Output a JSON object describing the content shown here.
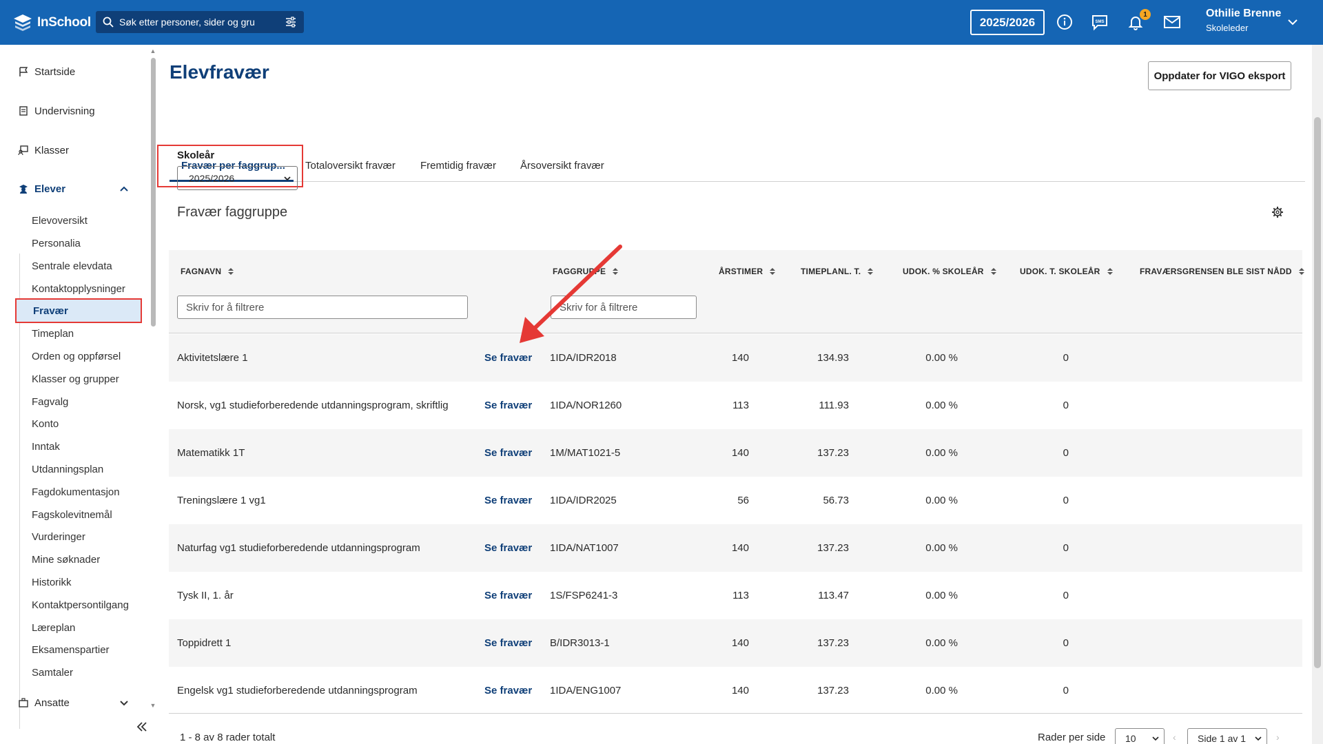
{
  "header": {
    "logo_text": "InSchool",
    "search_placeholder": "Søk etter personer, sider og gru",
    "school_year": "2025/2026",
    "notification_count": "1",
    "user_name": "Othilie Brenne",
    "user_role": "Skoleleder",
    "brand_color": "#1565b4"
  },
  "sidebar": {
    "top_items": [
      {
        "label": "Startside",
        "icon": "flag-icon"
      },
      {
        "label": "Undervisning",
        "icon": "book-icon"
      },
      {
        "label": "Klasser",
        "icon": "classroom-icon"
      },
      {
        "label": "Elever",
        "icon": "student-icon"
      }
    ],
    "sub_items": [
      "Elevoversikt",
      "Personalia",
      "Sentrale elevdata",
      "Kontaktopplysninger",
      "Fravær",
      "Timeplan",
      "Orden og oppførsel",
      "Klasser og grupper",
      "Fagvalg",
      "Konto",
      "Inntak",
      "Utdanningsplan",
      "Fagdokumentasjon",
      "Fagskolevitnemål",
      "Vurderinger",
      "Mine søknader",
      "Historikk",
      "Kontaktpersontilgang",
      "Læreplan",
      "Eksamenspartier",
      "Samtaler"
    ],
    "bottom_item": "Ansatte"
  },
  "main": {
    "title": "Elevfravær",
    "vigo_button": "Oppdater for VIGO eksport",
    "tabs": [
      "Fravær per faggrup...",
      "Totaloversikt fravær",
      "Fremtidig fravær",
      "Årsoversikt fravær"
    ],
    "active_tab": 0,
    "school_year_label": "Skoleår",
    "school_year_value": "2025/2026",
    "section_title": "Fravær faggruppe"
  },
  "table": {
    "columns": [
      "FAGNAVN",
      "FAGGRUPPE",
      "ÅRSTIMER",
      "TIMEPLANL. T.",
      "UDOK. % SKOLEÅR",
      "UDOK. T. SKOLEÅR",
      "FRAVÆRSGRENSEN BLE SIST NÅDD"
    ],
    "filter_placeholder": "Skriv for å filtrere",
    "link_label": "Se fravær",
    "rows": [
      {
        "fagnavn": "Aktivitetslære 1",
        "faggruppe": "1IDA/IDR2018",
        "arstimer": "140",
        "timeplan": "134.93",
        "udok_pct": "0.00 %",
        "udok_t": "0"
      },
      {
        "fagnavn": "Norsk, vg1 studieforberedende utdanningsprogram, skriftlig",
        "faggruppe": "1IDA/NOR1260",
        "arstimer": "113",
        "timeplan": "111.93",
        "udok_pct": "0.00 %",
        "udok_t": "0"
      },
      {
        "fagnavn": "Matematikk 1T",
        "faggruppe": "1M/MAT1021-5",
        "arstimer": "140",
        "timeplan": "137.23",
        "udok_pct": "0.00 %",
        "udok_t": "0"
      },
      {
        "fagnavn": "Treningslære 1 vg1",
        "faggruppe": "1IDA/IDR2025",
        "arstimer": "56",
        "timeplan": "56.73",
        "udok_pct": "0.00 %",
        "udok_t": "0"
      },
      {
        "fagnavn": "Naturfag vg1 studieforberedende utdanningsprogram",
        "faggruppe": "1IDA/NAT1007",
        "arstimer": "140",
        "timeplan": "137.23",
        "udok_pct": "0.00 %",
        "udok_t": "0"
      },
      {
        "fagnavn": "Tysk II, 1. år",
        "faggruppe": "1S/FSP6241-3",
        "arstimer": "113",
        "timeplan": "113.47",
        "udok_pct": "0.00 %",
        "udok_t": "0"
      },
      {
        "fagnavn": "Toppidrett 1",
        "faggruppe": "B/IDR3013-1",
        "arstimer": "140",
        "timeplan": "137.23",
        "udok_pct": "0.00 %",
        "udok_t": "0"
      },
      {
        "fagnavn": "Engelsk vg1 studieforberedende utdanningsprogram",
        "faggruppe": "1IDA/ENG1007",
        "arstimer": "140",
        "timeplan": "137.23",
        "udok_pct": "0.00 %",
        "udok_t": "0"
      }
    ]
  },
  "footer": {
    "total": "1 - 8 av 8 rader totalt",
    "rows_per_page_label": "Rader per side",
    "rows_per_page": "10",
    "page": "Side 1 av 1"
  }
}
